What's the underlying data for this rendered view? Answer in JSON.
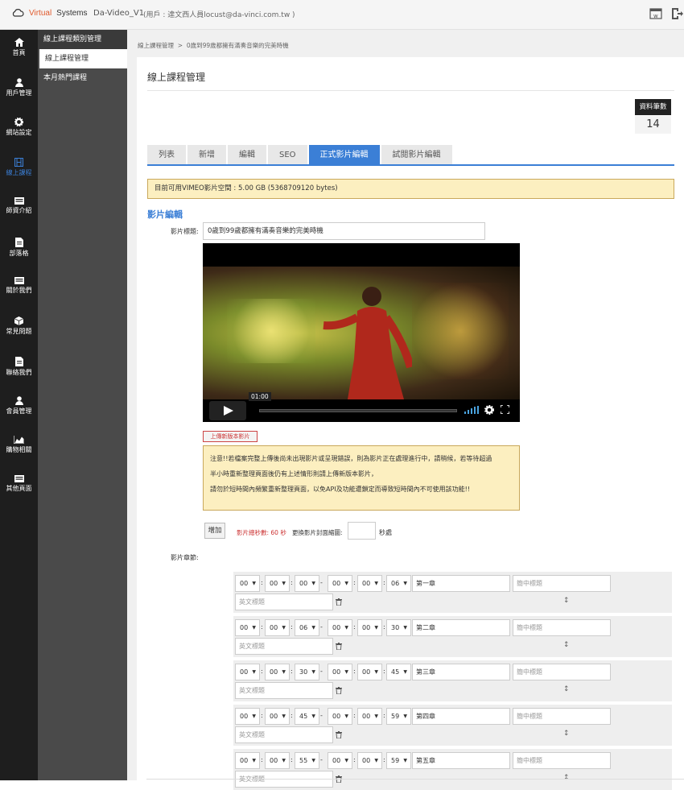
{
  "topbar": {
    "brand_virtual": "Virtual",
    "brand_systems": "Systems",
    "project": "Da-Video_V1",
    "user": "(用戶 : 達文西人員locust@da-vinci.com.tw )"
  },
  "sidenav": [
    {
      "label": "首頁",
      "icon": "home-icon"
    },
    {
      "label": "用戶管理",
      "icon": "user-icon"
    },
    {
      "label": "網站設定",
      "icon": "gear-icon"
    },
    {
      "label": "線上課程",
      "icon": "film-icon",
      "active": true
    },
    {
      "label": "師資介紹",
      "icon": "card-icon"
    },
    {
      "label": "部落格",
      "icon": "document-icon"
    },
    {
      "label": "關於我們",
      "icon": "card-icon"
    },
    {
      "label": "常見問題",
      "icon": "box-icon"
    },
    {
      "label": "聯絡我們",
      "icon": "document-icon"
    },
    {
      "label": "會員管理",
      "icon": "user-icon"
    },
    {
      "label": "購物相關",
      "icon": "chart-icon"
    },
    {
      "label": "其他頁面",
      "icon": "card-icon"
    }
  ],
  "subnav": {
    "head": "線上課程類別管理",
    "active": "線上課程管理",
    "item": "本月熱門課程"
  },
  "breadcrumb": {
    "parent": "線上課程管理",
    "sep": ">",
    "current": "0歲到99歲都擁有滿奏音樂的完美時機"
  },
  "page": {
    "title": "線上課程管理",
    "count_label": "資料筆數",
    "count_value": "14"
  },
  "tabs": [
    "列表",
    "新增",
    "編輯",
    "SEO",
    "正式影片編輯",
    "試閱影片編輯"
  ],
  "active_tab": "正式影片編輯",
  "vimeo_notice": "目前可用VIMEO影片空間 : 5.00 GB (5368709120 bytes)",
  "video_edit": {
    "section_title": "影片編輯",
    "title_label": "影片標題:",
    "title_value": "0歲到99歲都擁有滿奏音樂的完美時機",
    "time_tooltip": "01:00",
    "upload_label": "上傳新版本影片",
    "warning_lines": [
      "注意!!若檔案完整上傳後尚未出現影片或呈現錯誤，則為影片正在處理進行中，請稍候，若等待超過",
      "半小時重新整理頁面後仍有上述情形則請上傳新版本影片，",
      "請勿於短時間內頻繁重新整理頁面，以免API及功能遭鎖定而導致短時間內不可使用該功能!!"
    ]
  },
  "chapters": {
    "label": "影片章節:",
    "add_label": "增加",
    "duration_text": "影片總秒數: 60 秒",
    "cover_text": "更換影片封面縮圖:",
    "seconds_suffix": "秒處",
    "zh_placeholder": "簡中標題",
    "en_placeholder": "英文標題",
    "rows": [
      {
        "start": [
          "00",
          "00",
          "00"
        ],
        "end": [
          "00",
          "00",
          "06"
        ],
        "title": "第一章"
      },
      {
        "start": [
          "00",
          "00",
          "06"
        ],
        "end": [
          "00",
          "00",
          "30"
        ],
        "title": "第二章"
      },
      {
        "start": [
          "00",
          "00",
          "30"
        ],
        "end": [
          "00",
          "00",
          "45"
        ],
        "title": "第三章"
      },
      {
        "start": [
          "00",
          "00",
          "45"
        ],
        "end": [
          "00",
          "00",
          "59"
        ],
        "title": "第四章"
      },
      {
        "start": [
          "00",
          "00",
          "55"
        ],
        "end": [
          "00",
          "00",
          "59"
        ],
        "title": "第五章"
      }
    ]
  },
  "colors": {
    "accent": "#3b7fd6",
    "brand": "#e05a2c",
    "notice_bg": "#fcefc0",
    "sidebar": "#1e1e1e"
  }
}
